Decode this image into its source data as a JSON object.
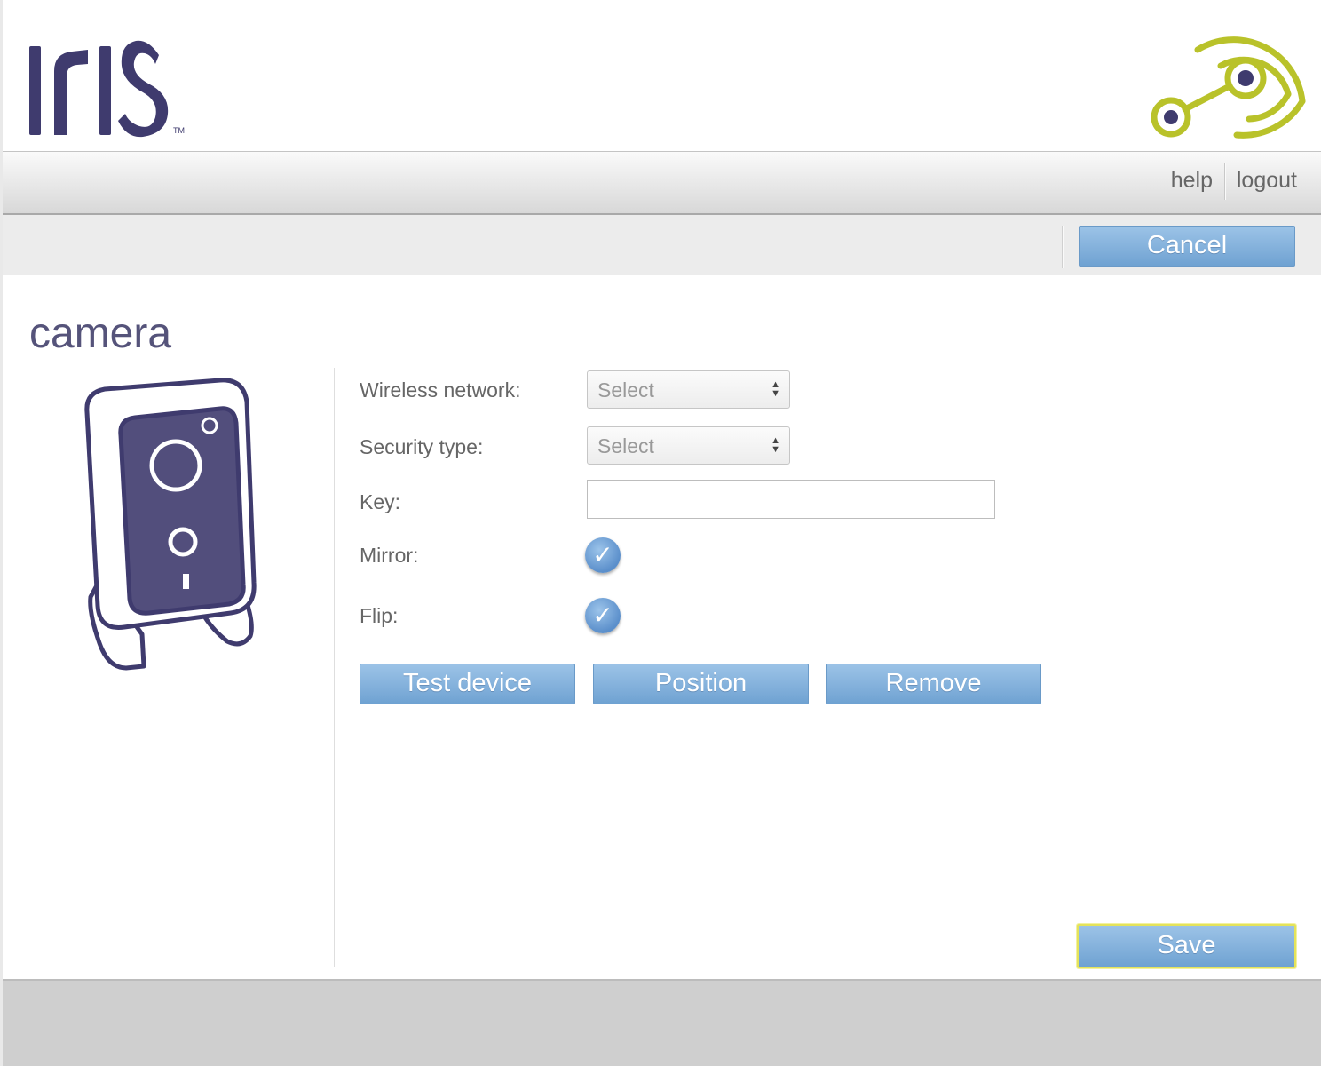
{
  "brand": {
    "name": "IrIS",
    "trademark": "TM",
    "logo_color": "#3f3b6e",
    "accent_color": "#b9c22a"
  },
  "nav": {
    "help_label": "help",
    "logout_label": "logout"
  },
  "toolbar": {
    "cancel_label": "Cancel"
  },
  "page": {
    "title": "camera"
  },
  "form": {
    "wireless_network": {
      "label": "Wireless network:",
      "value": "Select"
    },
    "security_type": {
      "label": "Security type:",
      "value": "Select"
    },
    "key": {
      "label": "Key:",
      "value": ""
    },
    "mirror": {
      "label": "Mirror:",
      "checked": true
    },
    "flip": {
      "label": "Flip:",
      "checked": true
    }
  },
  "actions": {
    "test_device_label": "Test device",
    "position_label": "Position",
    "remove_label": "Remove",
    "save_label": "Save"
  },
  "icons": {
    "checkmark": "checkmark-icon",
    "select_arrows": "updown-arrows-icon",
    "camera": "camera-device-icon",
    "brand_mark": "signal-target-icon"
  },
  "colors": {
    "button": "#78a9d8",
    "save_focus": "#e4e35a",
    "footer": "#cfcfcf"
  }
}
